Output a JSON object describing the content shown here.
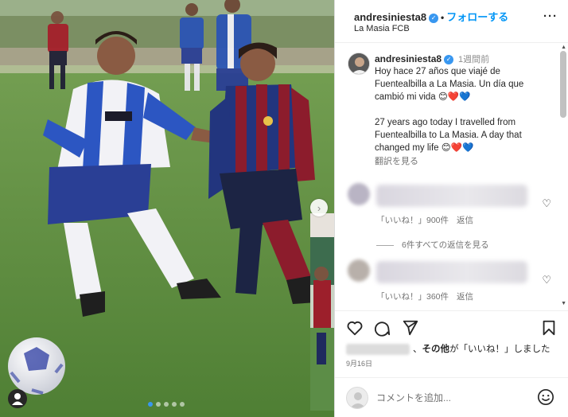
{
  "post": {
    "username": "andresiniesta8",
    "verified_mark": "✓",
    "separator": "•",
    "follow_label": "フォローする",
    "location": "La Masia FCB",
    "more_icon": "more-horizontal-icon"
  },
  "caption": {
    "username": "andresiniesta8",
    "time": "1週間前",
    "text_es": "Hoy hace 27 años que viajé de Fuentealbilla a La Masia. Un día que cambió mi vida 😊❤️💙",
    "text_en": "27 years ago today I travelled from Fuentealbilla to La Masia. A day that changed my life 😊❤️💙",
    "translate_label": "翻訳を見る"
  },
  "comments": [
    {
      "likes": "「いいね！」900件",
      "reply_label": "返信"
    },
    {
      "likes": "「いいね！」360件",
      "reply_label": "返信"
    }
  ],
  "view_replies": "6件すべての返信を見る",
  "likes_line": {
    "sep": "、",
    "others": "その他",
    "suffix": "が「いいね！」しました"
  },
  "date": "9月16日",
  "add_comment": {
    "placeholder": "コメントを追加..."
  },
  "media": {
    "carousel_count": 5,
    "carousel_active": 0
  },
  "colors": {
    "accent": "#0095f6",
    "verified": "#3897f0",
    "text": "#262626",
    "muted": "#737373"
  }
}
